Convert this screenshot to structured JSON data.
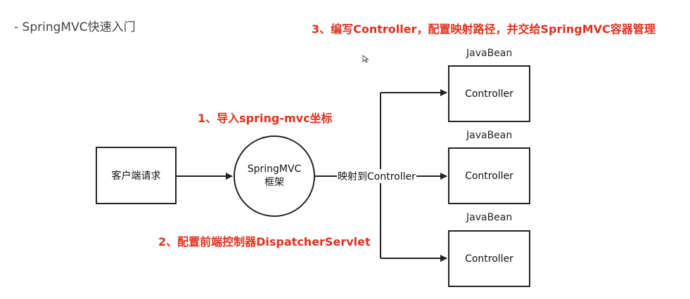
{
  "page_title": "- SpringMVC快速入门",
  "notes": {
    "step1": "1、导入spring-mvc坐标",
    "step2": "2、配置前端控制器DispatcherServlet",
    "step3": "3、编写Controller，配置映射路径，并交给SpringMVC容器管理"
  },
  "diagram": {
    "client_request": "客户端请求",
    "framework": "SpringMVC框架",
    "mapping_label": "映射到Controller",
    "controllers": [
      {
        "bean_label": "JavaBean",
        "name": "Controller"
      },
      {
        "bean_label": "JavaBean",
        "name": "Controller"
      },
      {
        "bean_label": "JavaBean",
        "name": "Controller"
      }
    ]
  },
  "colors": {
    "note_text": "#e0301e",
    "line": "#222222"
  },
  "icons": {
    "cursor": "mouse-pointer-icon"
  }
}
